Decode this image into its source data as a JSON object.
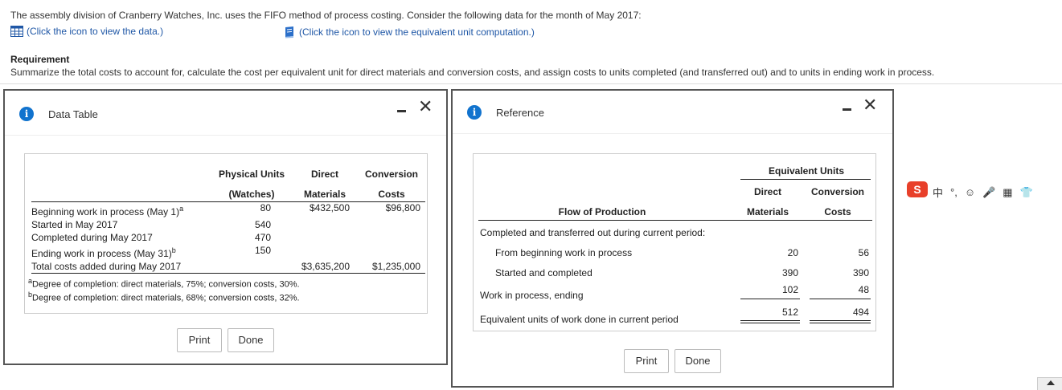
{
  "page": {
    "intro": "The assembly division of Cranberry Watches, Inc. uses the FIFO method of process costing. Consider the following data for the month of May 2017:",
    "link_data": "(Click the icon to view the data.)",
    "link_equiv": "(Click the icon to view the equivalent unit computation.)",
    "requirement_title": "Requirement",
    "requirement_text": "Summarize the total costs to account for, calculate the cost per equivalent unit for direct materials and conversion costs, and assign costs to units completed (and transferred out) and to units in ending work in process."
  },
  "data_modal": {
    "title": "Data Table",
    "headers": {
      "physical_1": "Physical Units",
      "physical_2": "(Watches)",
      "direct_1": "Direct",
      "direct_2": "Materials",
      "conv_1": "Conversion",
      "conv_2": "Costs"
    },
    "rows": [
      {
        "label": "Beginning work in process (May 1)",
        "sup": "a",
        "units": "80",
        "dm": "$432,500",
        "cc": "$96,800"
      },
      {
        "label": "Started in May 2017",
        "sup": "",
        "units": "540",
        "dm": "",
        "cc": ""
      },
      {
        "label": "Completed during May 2017",
        "sup": "",
        "units": "470",
        "dm": "",
        "cc": ""
      },
      {
        "label": "Ending work in process (May 31)",
        "sup": "b",
        "units": "150",
        "dm": "",
        "cc": ""
      },
      {
        "label": "Total costs added during May 2017",
        "sup": "",
        "units": "",
        "dm": "$3,635,200",
        "cc": "$1,235,000"
      }
    ],
    "footnote_a_mark": "a",
    "footnote_a": "Degree of completion: direct materials, 75%; conversion costs, 30%.",
    "footnote_b_mark": "b",
    "footnote_b": "Degree of completion: direct materials, 68%; conversion costs, 32%.",
    "print_label": "Print",
    "done_label": "Done"
  },
  "ref_modal": {
    "title": "Reference",
    "headers": {
      "equiv_units": "Equivalent Units",
      "direct_1": "Direct",
      "direct_2": "Materials",
      "conv_1": "Conversion",
      "conv_2": "Costs",
      "flow": "Flow of Production"
    },
    "rows": [
      {
        "label": "Completed and transferred out during current period:",
        "dm": "",
        "cc": ""
      },
      {
        "label": "From beginning work in process",
        "dm": "20",
        "cc": "56"
      },
      {
        "label": "Started and completed",
        "dm": "390",
        "cc": "390"
      },
      {
        "label": "Work in process, ending",
        "dm": "102",
        "cc": "48"
      },
      {
        "label": "Equivalent units of work done in current period",
        "dm": "512",
        "cc": "494"
      }
    ],
    "print_label": "Print",
    "done_label": "Done"
  },
  "ime_toolbar": {
    "logo": "S",
    "items": [
      "中",
      "°,",
      "☺",
      "🎤",
      "▦",
      "👕"
    ]
  }
}
